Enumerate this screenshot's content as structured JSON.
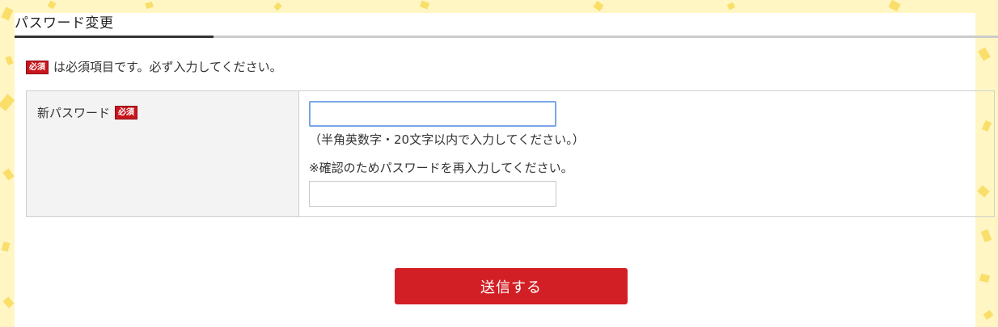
{
  "page": {
    "title": "パスワード変更"
  },
  "notice": {
    "badge": "必須",
    "text": "は必須項目です。必ず入力してください。"
  },
  "form": {
    "new_password_label": "新パスワード",
    "required_badge": "必須",
    "new_password_value": "",
    "hint": "（半角英数字・20文字以内で入力してください。）",
    "confirm_note": "※確認のためパスワードを再入力してください。",
    "confirm_password_value": ""
  },
  "actions": {
    "submit_label": "送信する"
  },
  "colors": {
    "accent": "#d21f25",
    "badge": "#c8161d",
    "background": "#fff6c4",
    "confetti": "#f8d95a"
  }
}
